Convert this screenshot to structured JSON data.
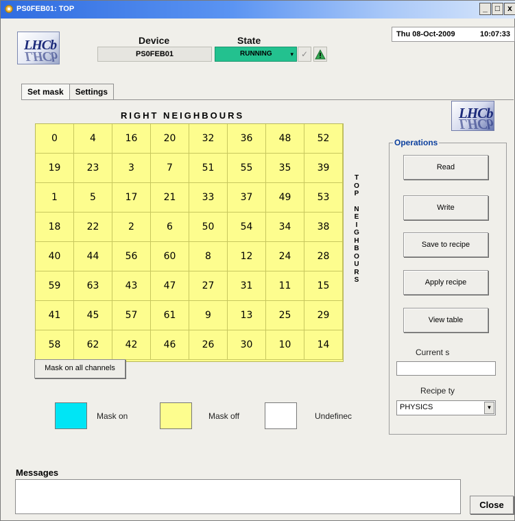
{
  "window": {
    "title": "PS0FEB01: TOP",
    "buttons": [
      "_",
      "□",
      "x"
    ]
  },
  "header": {
    "logo_text": "LHCb",
    "device_label": "Device",
    "device_value": "PS0FEB01",
    "state_label": "State",
    "state_value": "RUNNING",
    "state_color": "#23c18f",
    "date": "Thu 08-Oct-2009",
    "time": "10:07:33"
  },
  "tabs": [
    {
      "label": "Set mask",
      "active": true
    },
    {
      "label": "Settings",
      "active": false
    }
  ],
  "grid": {
    "title": "RIGHT NEIGHBOURS",
    "side_label": "TOP NEIGHBOURS",
    "rows": [
      [
        "0",
        "4",
        "16",
        "20",
        "32",
        "36",
        "48",
        "52"
      ],
      [
        "19",
        "23",
        "3",
        "7",
        "51",
        "55",
        "35",
        "39"
      ],
      [
        "1",
        "5",
        "17",
        "21",
        "33",
        "37",
        "49",
        "53"
      ],
      [
        "18",
        "22",
        "2",
        "6",
        "50",
        "54",
        "34",
        "38"
      ],
      [
        "40",
        "44",
        "56",
        "60",
        "8",
        "12",
        "24",
        "28"
      ],
      [
        "59",
        "63",
        "43",
        "47",
        "27",
        "31",
        "11",
        "15"
      ],
      [
        "41",
        "45",
        "57",
        "61",
        "9",
        "13",
        "25",
        "29"
      ],
      [
        "58",
        "62",
        "42",
        "46",
        "26",
        "30",
        "10",
        "14"
      ]
    ],
    "cell_color": "#fdfd8e"
  },
  "mask_all_label": "Mask on all channels",
  "legend": [
    {
      "label": "Mask on",
      "color": "#00e5f5"
    },
    {
      "label": "Mask off",
      "color": "#fdfd8e"
    },
    {
      "label": "Undefinec",
      "color": "#ffffff"
    }
  ],
  "operations": {
    "title": "Operations",
    "buttons": [
      "Read",
      "Write",
      "Save to recipe",
      "Apply recipe",
      "View table"
    ],
    "current_label": "Current s",
    "current_value": "",
    "recipe_label": "Recipe ty",
    "recipe_value": "PHYSICS"
  },
  "messages": {
    "label": "Messages",
    "value": ""
  },
  "close_label": "Close"
}
